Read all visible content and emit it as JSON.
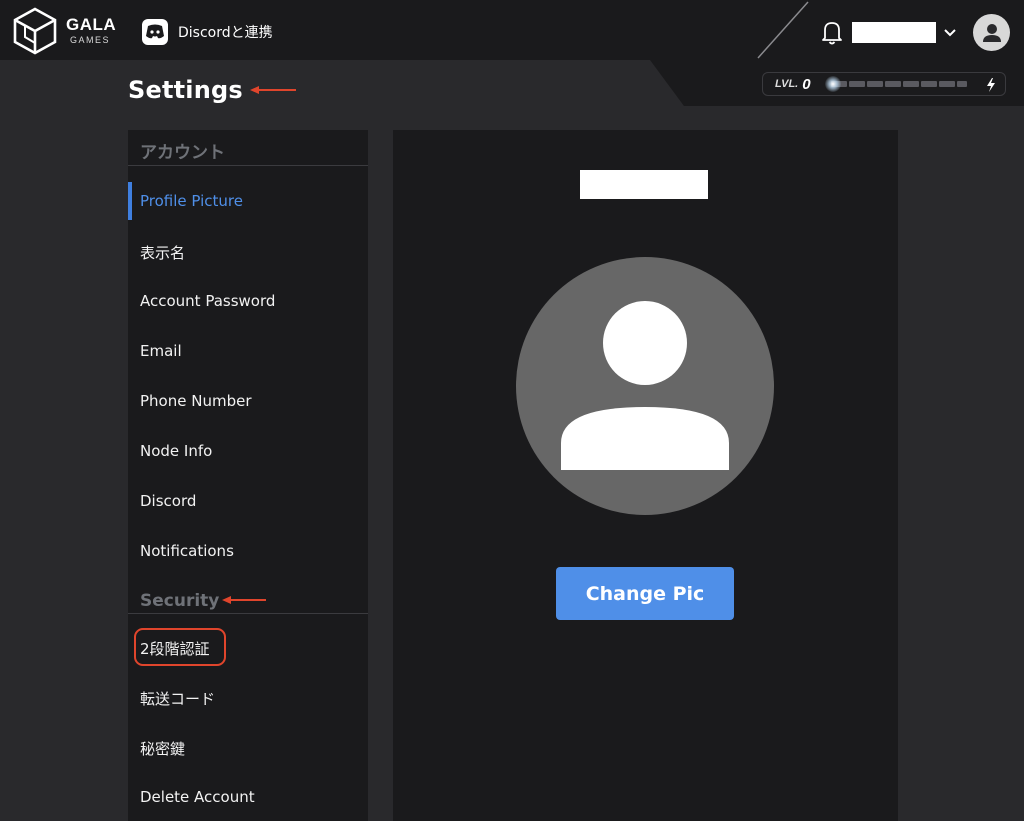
{
  "header": {
    "logo_text": "GALA",
    "logo_sub": "GAMES",
    "discord_link": "Discordと連携",
    "level_label": "LVL.",
    "level_value": "0",
    "icons": {
      "logo": "gala-cube-icon",
      "discord": "discord-icon",
      "bell": "bell-icon",
      "chevron": "chevron-down-icon",
      "avatar": "user-avatar-icon",
      "bolt": "lightning-bolt-icon"
    }
  },
  "page": {
    "title": "Settings"
  },
  "sidebar": {
    "section_account": "アカウント",
    "items": [
      {
        "label": "Profile Picture",
        "active": true
      },
      {
        "label": "表示名"
      },
      {
        "label": "Account Password"
      },
      {
        "label": "Email"
      },
      {
        "label": "Phone Number"
      },
      {
        "label": "Node Info"
      },
      {
        "label": "Discord"
      },
      {
        "label": "Notifications"
      }
    ],
    "section_security": "Security",
    "security_items": [
      {
        "label": "2段階認証",
        "highlighted": true
      },
      {
        "label": "転送コード"
      },
      {
        "label": "秘密鍵"
      },
      {
        "label": "Delete Account"
      }
    ]
  },
  "main": {
    "change_pic_label": "Change Pic"
  },
  "colors": {
    "background": "#29292c",
    "panel": "#1a1a1c",
    "accent_blue": "#4f8fe8",
    "annotation_red": "#e0452c",
    "avatar_gray": "#676767"
  }
}
